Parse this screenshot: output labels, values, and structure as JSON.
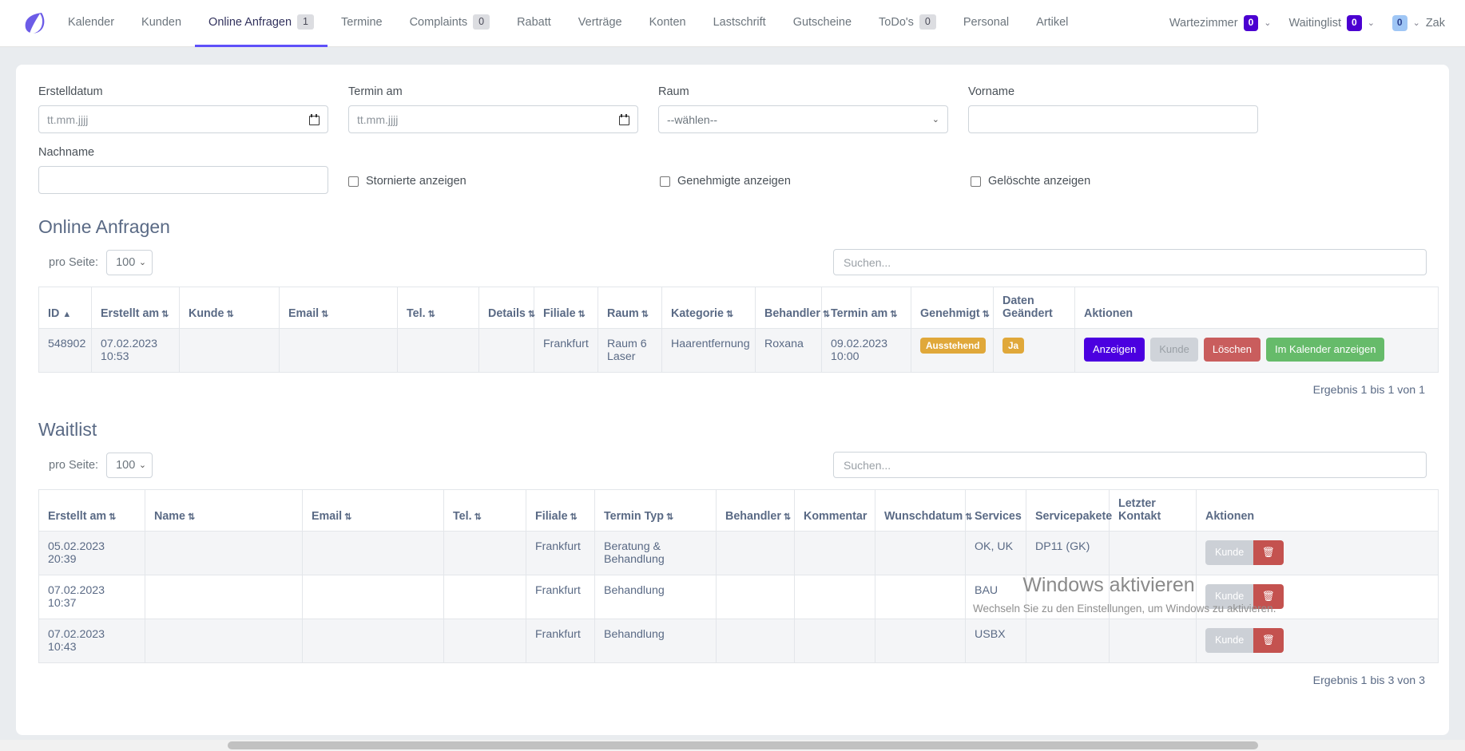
{
  "navbar": {
    "brand_icon": "leaf-logo",
    "items": [
      {
        "label": "Kalender",
        "badge": null,
        "active": false
      },
      {
        "label": "Kunden",
        "badge": null,
        "active": false
      },
      {
        "label": "Online Anfragen",
        "badge": "1",
        "active": true
      },
      {
        "label": "Termine",
        "badge": null,
        "active": false
      },
      {
        "label": "Complaints",
        "badge": "0",
        "active": false
      },
      {
        "label": "Rabatt",
        "badge": null,
        "active": false
      },
      {
        "label": "Verträge",
        "badge": null,
        "active": false
      },
      {
        "label": "Konten",
        "badge": null,
        "active": false
      },
      {
        "label": "Lastschrift",
        "badge": null,
        "active": false
      },
      {
        "label": "Gutscheine",
        "badge": null,
        "active": false
      },
      {
        "label": "ToDo's",
        "badge": "0",
        "active": false
      },
      {
        "label": "Personal",
        "badge": null,
        "active": false
      },
      {
        "label": "Artikel",
        "badge": null,
        "active": false
      }
    ],
    "right": [
      {
        "label": "Wartezimmer",
        "badge": "0",
        "badge_style": "purple",
        "caret": "⌄"
      },
      {
        "label": "Waitinglist",
        "badge": "0",
        "badge_style": "purple",
        "caret": "⌄"
      },
      {
        "label": "Zak",
        "badge": "0",
        "badge_style": "lightblue",
        "caret": "⌄"
      }
    ]
  },
  "filters": {
    "erstelldatum": {
      "label": "Erstelldatum",
      "placeholder": "tt.mm.jjjj",
      "value": ""
    },
    "termin_am": {
      "label": "Termin am",
      "placeholder": "tt.mm.jjjj",
      "value": ""
    },
    "raum": {
      "label": "Raum",
      "selected": "--wählen--"
    },
    "vorname": {
      "label": "Vorname",
      "value": ""
    },
    "nachname": {
      "label": "Nachname",
      "value": ""
    },
    "checkboxes": [
      {
        "label": "Stornierte anzeigen",
        "checked": false
      },
      {
        "label": "Genehmigte anzeigen",
        "checked": false
      },
      {
        "label": "Gelöschte anzeigen",
        "checked": false
      }
    ]
  },
  "online_anfragen": {
    "title": "Online Anfragen",
    "per_page_label": "pro Seite:",
    "per_page_value": "100",
    "search_placeholder": "Suchen...",
    "columns": [
      {
        "label": "ID",
        "sort": "asc"
      },
      {
        "label": "Erstellt am",
        "sort": "both"
      },
      {
        "label": "Kunde",
        "sort": "both"
      },
      {
        "label": "Email",
        "sort": "both"
      },
      {
        "label": "Tel.",
        "sort": "both"
      },
      {
        "label": "Details",
        "sort": "both"
      },
      {
        "label": "Filiale",
        "sort": "both"
      },
      {
        "label": "Raum",
        "sort": "both"
      },
      {
        "label": "Kategorie",
        "sort": "both"
      },
      {
        "label": "Behandler",
        "sort": "both"
      },
      {
        "label": "Termin am",
        "sort": "both"
      },
      {
        "label": "Genehmigt",
        "sort": "both"
      },
      {
        "label": "Daten Geändert",
        "sort": "none"
      },
      {
        "label": "Aktionen",
        "sort": "none"
      }
    ],
    "rows": [
      {
        "id": "548902",
        "erstellt_am": "07.02.2023 10:53",
        "kunde": "",
        "email": "",
        "tel": "",
        "details": "",
        "filiale": "Frankfurt",
        "raum": "Raum 6 Laser",
        "kategorie": "Haarentfernung",
        "behandler": "Roxana",
        "termin_am": "09.02.2023 10:00",
        "genehmigt": "Ausstehend",
        "daten_geaendert": "Ja",
        "actions": [
          "Anzeigen",
          "Kunde",
          "Löschen",
          "Im Kalender anzeigen"
        ]
      }
    ],
    "result_text": "Ergebnis 1 bis 1 von 1"
  },
  "waitlist": {
    "title": "Waitlist",
    "per_page_label": "pro Seite:",
    "per_page_value": "100",
    "search_placeholder": "Suchen...",
    "columns": [
      {
        "label": "Erstellt am",
        "sort": "both"
      },
      {
        "label": "Name",
        "sort": "both"
      },
      {
        "label": "Email",
        "sort": "both"
      },
      {
        "label": "Tel.",
        "sort": "both"
      },
      {
        "label": "Filiale",
        "sort": "both"
      },
      {
        "label": "Termin Typ",
        "sort": "both"
      },
      {
        "label": "Behandler",
        "sort": "both"
      },
      {
        "label": "Kommentar",
        "sort": "none"
      },
      {
        "label": "Wunschdatum",
        "sort": "both"
      },
      {
        "label": "Services",
        "sort": "none"
      },
      {
        "label": "Servicepakete",
        "sort": "none"
      },
      {
        "label": "Letzter Kontakt",
        "sort": "none"
      },
      {
        "label": "Aktionen",
        "sort": "none"
      }
    ],
    "rows": [
      {
        "erstellt_am": "05.02.2023 20:39",
        "name": "",
        "email": "",
        "tel": "",
        "filiale": "Frankfurt",
        "termin_typ": "Beratung & Behandlung",
        "behandler": "",
        "kommentar": "",
        "wunschdatum": "",
        "services": "OK, UK",
        "servicepakete": "DP11 (GK)",
        "letzter_kontakt": "",
        "action_label": "Kunde",
        "action_delete_icon": "trash-icon"
      },
      {
        "erstellt_am": "07.02.2023 10:37",
        "name": "",
        "email": "",
        "tel": "",
        "filiale": "Frankfurt",
        "termin_typ": "Behandlung",
        "behandler": "",
        "kommentar": "",
        "wunschdatum": "",
        "services": "BAU",
        "servicepakete": "",
        "letzter_kontakt": "",
        "action_label": "Kunde",
        "action_delete_icon": "trash-icon"
      },
      {
        "erstellt_am": "07.02.2023 10:43",
        "name": "",
        "email": "",
        "tel": "",
        "filiale": "Frankfurt",
        "termin_typ": "Behandlung",
        "behandler": "",
        "kommentar": "",
        "wunschdatum": "",
        "services": "USBX",
        "servicepakete": "",
        "letzter_kontakt": "",
        "action_label": "Kunde",
        "action_delete_icon": "trash-icon"
      }
    ],
    "result_text": "Ergebnis 1 bis 3 von 3"
  },
  "watermark": {
    "line1": "Windows aktivieren",
    "line2": "Wechseln Sie zu den Einstellungen, um Windows zu aktivieren."
  },
  "colors": {
    "accent_purple": "#5e50f9",
    "button_purple": "#4b00e0",
    "button_green": "#66bb6a",
    "button_red": "#c95d5d",
    "badge_amber": "#e0a83a"
  }
}
